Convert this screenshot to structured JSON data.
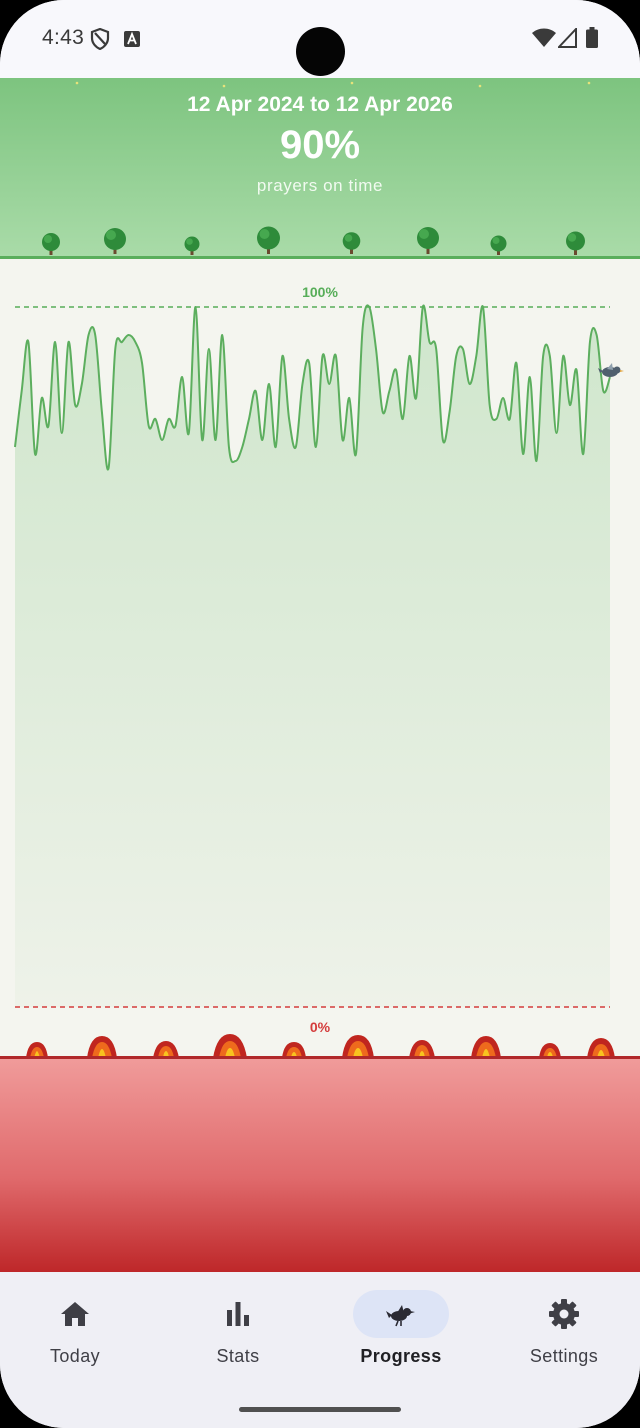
{
  "status_bar": {
    "time": "4:43",
    "left_icons": [
      "shield-icon",
      "font-a-icon"
    ],
    "right_icons": [
      "wifi-icon",
      "signal-icon",
      "battery-icon"
    ]
  },
  "header": {
    "date_range": "12 Apr 2024 to 12 Apr 2026",
    "percentage": "90%",
    "subtitle": "prayers on time",
    "color": "#7dc47f"
  },
  "chart_data": {
    "type": "area",
    "title": "",
    "ylim": [
      0,
      100
    ],
    "reference_lines": [
      {
        "label": "100%",
        "value": 100,
        "color": "#56ad58"
      },
      {
        "label": "0%",
        "value": 0,
        "color": "#d43c3c"
      }
    ],
    "series": [
      {
        "color": "#5cae5e",
        "values": [
          80,
          88,
          95,
          79,
          87,
          83,
          95,
          82,
          95,
          86,
          89,
          96,
          96,
          85,
          77,
          94,
          95,
          96,
          95,
          92,
          83,
          84,
          81,
          84,
          83,
          90,
          82,
          100,
          81,
          94,
          81,
          96,
          80,
          78,
          80,
          84,
          88,
          81,
          89,
          80,
          93,
          84,
          80,
          89,
          92,
          80,
          93,
          89,
          93,
          81,
          87,
          79,
          97,
          100,
          94,
          85,
          88,
          91,
          84,
          93,
          87,
          100,
          95,
          94,
          81,
          85,
          93,
          94,
          89,
          93,
          100,
          86,
          84,
          87,
          84,
          92,
          79,
          90,
          78,
          93,
          93,
          82,
          93,
          86,
          91,
          79,
          95,
          96,
          88,
          90
        ]
      }
    ],
    "grid": true
  },
  "nav": {
    "items": [
      {
        "label": "Today",
        "icon": "home-icon",
        "active": false
      },
      {
        "label": "Stats",
        "icon": "bar-chart-icon",
        "active": false
      },
      {
        "label": "Progress",
        "icon": "bird-icon",
        "active": true
      },
      {
        "label": "Settings",
        "icon": "gear-icon",
        "active": false
      }
    ]
  }
}
